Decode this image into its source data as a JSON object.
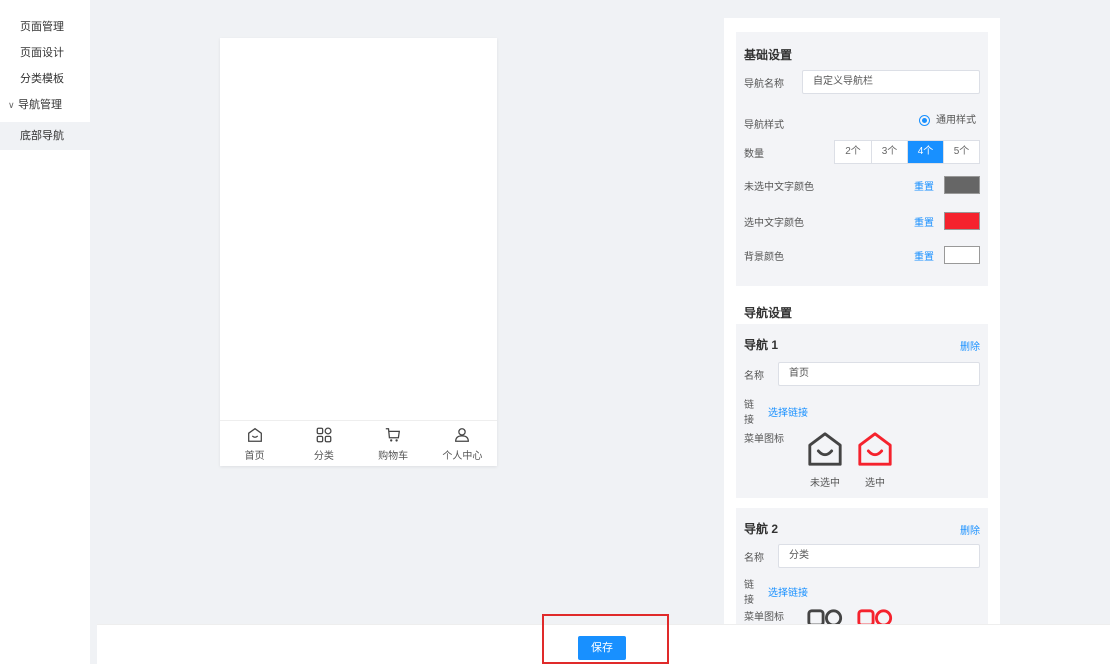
{
  "sidebar": {
    "items": [
      {
        "label": "页面管理"
      },
      {
        "label": "页面设计"
      },
      {
        "label": "分类模板"
      },
      {
        "label": "导航管理"
      },
      {
        "label": "底部导航"
      }
    ]
  },
  "preview": {
    "tabs": [
      {
        "label": "首页",
        "icon": "home-icon"
      },
      {
        "label": "分类",
        "icon": "grid-icon"
      },
      {
        "label": "购物车",
        "icon": "cart-icon"
      },
      {
        "label": "个人中心",
        "icon": "user-icon"
      }
    ]
  },
  "basic": {
    "title": "基础设置",
    "nav_name_label": "导航名称",
    "nav_name_value": "自定义导航栏",
    "style_label": "导航样式",
    "style_option": "通用样式",
    "count_label": "数量",
    "count_options": [
      "2个",
      "3个",
      "4个",
      "5个"
    ],
    "count_selected": "4个",
    "unselected_color_label": "未选中文字颜色",
    "selected_color_label": "选中文字颜色",
    "bg_color_label": "背景颜色",
    "reset_label": "重置",
    "colors": {
      "unselected": "#666666",
      "selected": "#f5222d",
      "background": "#ffffff"
    }
  },
  "nav_settings": {
    "title": "导航设置",
    "items": [
      {
        "title": "导航 1",
        "delete_label": "删除",
        "name_label": "名称",
        "name_value": "首页",
        "link_label": "链接",
        "link_action": "选择链接",
        "icon_label": "菜单图标",
        "unselected_caption": "未选中",
        "selected_caption": "选中"
      },
      {
        "title": "导航 2",
        "delete_label": "删除",
        "name_label": "名称",
        "name_value": "分类",
        "link_label": "链接",
        "link_action": "选择链接",
        "icon_label": "菜单图标"
      }
    ]
  },
  "footer": {
    "save_label": "保存"
  },
  "accent": "#1890ff"
}
